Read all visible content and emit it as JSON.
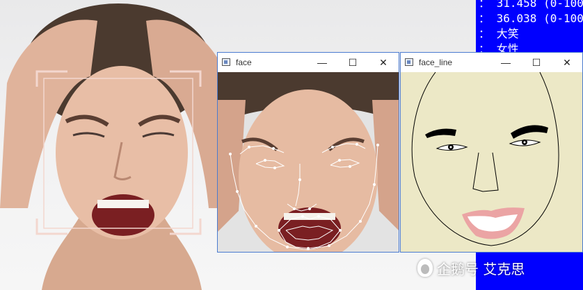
{
  "console": {
    "lines": [
      "：  31.458 (0-100",
      "：  36.038 (0-100",
      "：  大笑",
      "：  女性"
    ]
  },
  "windows": {
    "face": {
      "title": "face"
    },
    "face_line": {
      "title": "face_line"
    }
  },
  "controls": {
    "minimize": "—",
    "maximize": "☐",
    "close": "✕"
  },
  "watermark": {
    "text": "企鹅号 艾克思"
  },
  "colors": {
    "console_bg": "#0000ff",
    "face_line_bg": "#ece8c6",
    "landmark": "#ffffff",
    "detection_box": "#f3d7cf",
    "lips": "#eba4a4"
  }
}
